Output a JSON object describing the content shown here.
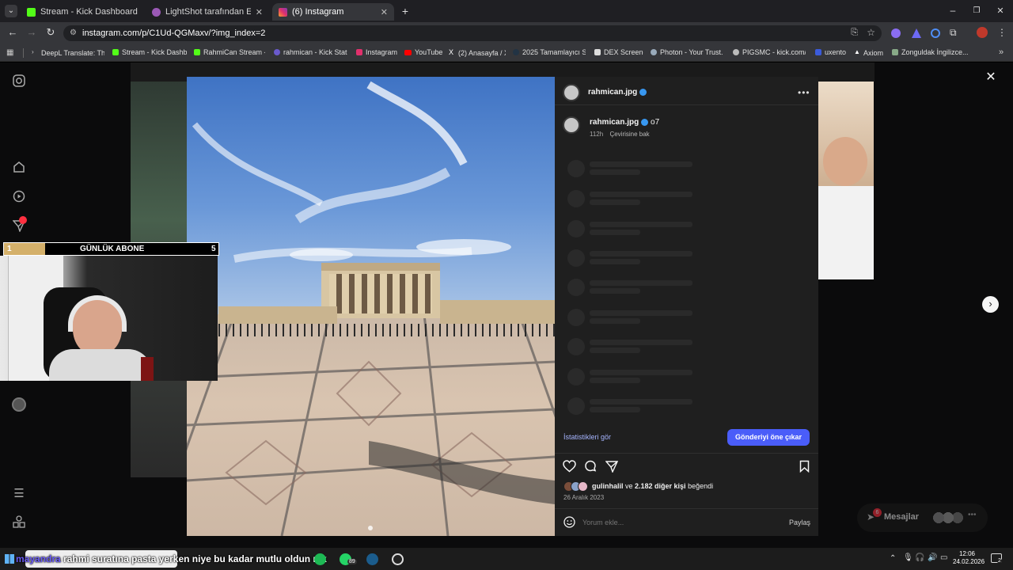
{
  "browser": {
    "tabs": [
      {
        "label": "Stream - Kick Dashboard",
        "color": "#53fc18",
        "active": false
      },
      {
        "label": "LightShot tarafından Ekran Gör",
        "color": "#9b59b6",
        "active": false
      },
      {
        "label": "(6) Instagram",
        "color": "#e1306c",
        "active": true
      }
    ],
    "url": "instagram.com/p/C1Ud-QGMaxv/?img_index=2",
    "bookmarks": [
      "DeepL Translate: Th...",
      "Stream - Kick Dashb...",
      "RahmiCan Stream -...",
      "rahmican - Kick Stat...",
      "Instagram",
      "YouTube",
      "(2) Anasayfa / X",
      "2025 Tamamlayıcı S...",
      "DEX Screener",
      "Photon - Your Trust...",
      "PIGSMC - kick.com/...",
      "uxento",
      "Axiom",
      "Zonguldak İngilizce..."
    ]
  },
  "instagram": {
    "rail_badge": "",
    "post": {
      "author": "rahmican.jpg",
      "caption_author": "rahmican.jpg",
      "caption": "o7",
      "time": "112h",
      "translate": "Çevirisine bak",
      "insights": "İstatistikleri gör",
      "boost": "Gönderiyi öne çıkar",
      "likes_user": "gulinhalil",
      "likes_mid": " ve ",
      "likes_count": "2.182 diğer kişi",
      "likes_end": " beğendi",
      "date": "26 Aralık 2023",
      "comment_placeholder": "Yorum ekle...",
      "share": "Paylaş"
    },
    "messages": {
      "label": "Mesajlar",
      "badge": "6"
    }
  },
  "overlay": {
    "abone_left": "1",
    "abone_title": "GÜNLÜK ABONE",
    "abone_right": "5",
    "chat_user": "mayandra",
    "chat_text": "rahmi suratına pasta yerken niye bu kadar mutlu oldun mk"
  },
  "taskbar": {
    "time": "12:06",
    "date": "24.02.2026",
    "whatsapp_badge": "89",
    "notif_badge": "2"
  }
}
